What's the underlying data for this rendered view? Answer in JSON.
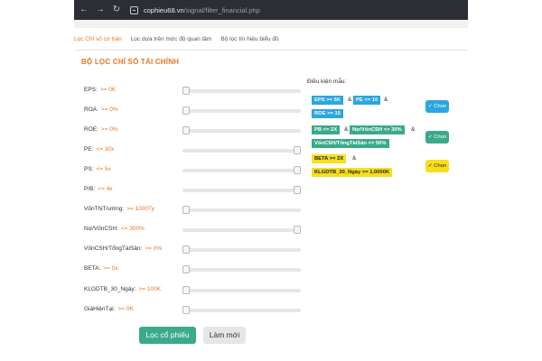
{
  "browser": {
    "url_host": "cophieu68.vn",
    "url_path": "/signal/filter_financial.php"
  },
  "tabs": [
    {
      "label": "Lọc Chỉ số cơ bản",
      "active": true
    },
    {
      "label": "Lọc dựa trên mức độ quan tâm",
      "active": false
    },
    {
      "label": "Bộ lọc tín hiệu biểu đồ",
      "active": false
    }
  ],
  "section_title": "BỘ LỌC CHỈ SỐ TÀI CHÍNH",
  "filters": [
    {
      "label": "EPS:",
      "condition": ">= 0K",
      "level": 0.0
    },
    {
      "label": "ROA:",
      "condition": ">= 0%",
      "level": 0.0
    },
    {
      "label": "ROE:",
      "condition": ">= 0%",
      "level": 0.0
    },
    {
      "label": "PE:",
      "condition": "<= 30x",
      "level": 1.0
    },
    {
      "label": "PS:",
      "condition": "<= 5x",
      "level": 1.0
    },
    {
      "label": "P/B:",
      "condition": "<= 4x",
      "level": 1.0
    },
    {
      "label": "VốnThịTrường:",
      "condition": ">= 1000Ty",
      "level": 0.0
    },
    {
      "label": "Nợ/VốnCSH:",
      "condition": "<= 300%",
      "level": 1.0
    },
    {
      "label": "VốnCSH/TổngTàiSản:",
      "condition": ">= 0%",
      "level": 0.0
    },
    {
      "label": "BETA:",
      "condition": ">= 0x",
      "level": 0.0
    },
    {
      "label": "KLGDTB_30_Ngày:",
      "condition": ">= 100K",
      "level": 0.0
    },
    {
      "label": "GiáHiệnTại:",
      "condition": ">= 0K",
      "level": 0.0
    }
  ],
  "sample": {
    "title": "Điều kiện mẫu:",
    "presets": [
      {
        "chips": [
          "EPS >= 5K",
          "PE <= 10",
          "ROE >= 15"
        ],
        "button": "✓ Chọn",
        "color": "#2aa6e0"
      },
      {
        "chips": [
          "PB <= 2X",
          "Nợ/VốnCSH <= 30%",
          "VốnCSH/TổngTàiSản <= 50%"
        ],
        "button": "✓ Chọn",
        "color": "#3aaa8a"
      },
      {
        "chips": [
          "BETA >= 2X",
          "KLGDTB_30_Ngày >= 1.0000K"
        ],
        "button": "✓ Chọn",
        "color": "#f7df1e"
      }
    ],
    "amp": "&"
  },
  "buttons": {
    "filter": "Lọc cổ phiếu",
    "reset": "Làm mới"
  }
}
